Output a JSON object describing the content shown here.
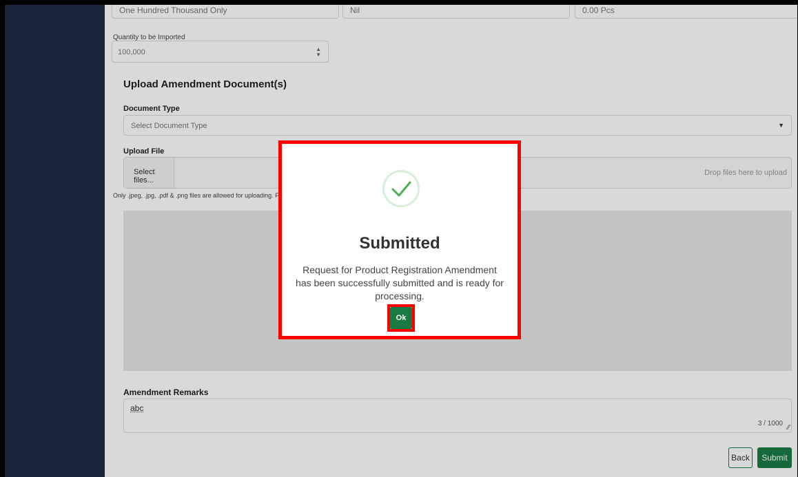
{
  "top_fields": {
    "field1_value": "One Hundred Thousand Only",
    "field2_value": "Nil",
    "field3_value": "0.00 Pcs"
  },
  "quantity": {
    "label": "Quantity to be Imported",
    "value": "100,000"
  },
  "amendment_docs": {
    "section_title": "Upload Amendment Document(s)",
    "document_type_label": "Document Type",
    "document_type_placeholder": "Select Document Type",
    "upload_label": "Upload File",
    "select_files_label": "Select files...",
    "drop_hint": "Drop files here to upload",
    "file_note": "Only .jpeg, .jpg, .pdf & .png files are allowed for uploading. File size"
  },
  "remarks": {
    "label": "Amendment Remarks",
    "value": "abc",
    "counter": "3 / 1000"
  },
  "actions": {
    "back_label": "Back",
    "submit_label": "Submit"
  },
  "modal": {
    "title": "Submitted",
    "message": "Request for Product Registration Amendment has been successfully submitted and is ready for processing.",
    "ok_label": "Ok",
    "check_color": "#4caf50",
    "highlight_color": "#ff0000"
  },
  "colors": {
    "sidebar": "#1e2a44",
    "accent_green": "#1a7a44"
  }
}
